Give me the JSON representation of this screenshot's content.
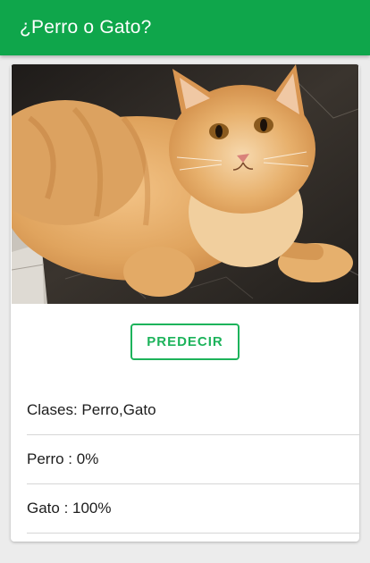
{
  "app": {
    "title": "¿Perro o Gato?"
  },
  "colors": {
    "appbar": "#0fa64b",
    "accent": "#1db35b"
  },
  "image": {
    "subject": "orange tabby cat lying on a dark marble floor"
  },
  "actions": {
    "predict_label": "PREDECIR"
  },
  "results": [
    {
      "text": "Clases: Perro,Gato"
    },
    {
      "text": "Perro : 0%"
    },
    {
      "text": "Gato : 100%"
    }
  ]
}
